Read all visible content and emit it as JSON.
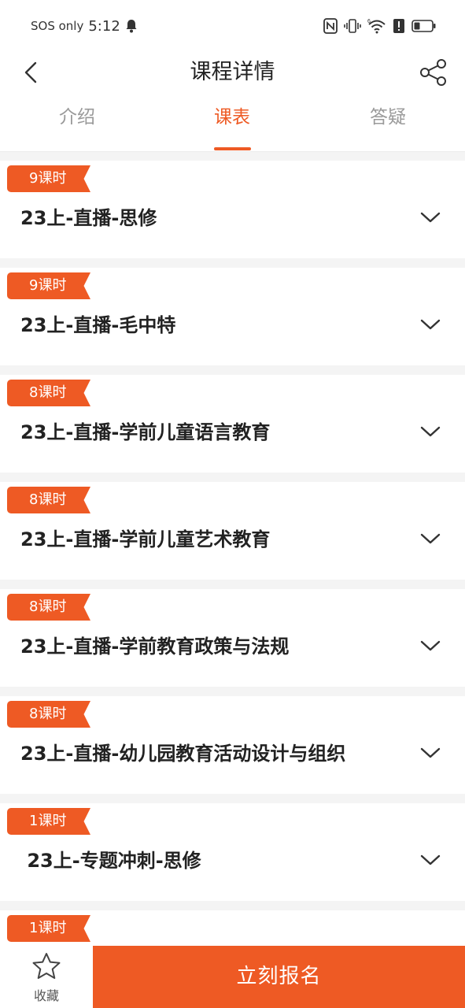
{
  "status": {
    "sos": "SOS only",
    "time": "5:12",
    "network": "6"
  },
  "header": {
    "title": "课程详情"
  },
  "tabs": [
    {
      "label": "介绍"
    },
    {
      "label": "课表"
    },
    {
      "label": "答疑"
    }
  ],
  "active_tab": "课表",
  "colors": {
    "accent": "#ee5a24",
    "text": "#222222",
    "muted": "#9a9a9a",
    "page_bg": "#f4f4f4"
  },
  "lessons": [
    {
      "hours": "9课时",
      "title": "23上-直播-思修"
    },
    {
      "hours": "9课时",
      "title": "23上-直播-毛中特"
    },
    {
      "hours": "8课时",
      "title": "23上-直播-学前儿童语言教育"
    },
    {
      "hours": "8课时",
      "title": "23上-直播-学前儿童艺术教育"
    },
    {
      "hours": "8课时",
      "title": "23上-直播-学前教育政策与法规"
    },
    {
      "hours": "8课时",
      "title": "23上-直播-幼儿园教育活动设计与组织"
    },
    {
      "hours": "1课时",
      "title": " 23上-专题冲刺-思修"
    },
    {
      "hours": "1课时",
      "title": ""
    }
  ],
  "bottom": {
    "favorite_label": "收藏",
    "enroll_label": "立刻报名"
  }
}
